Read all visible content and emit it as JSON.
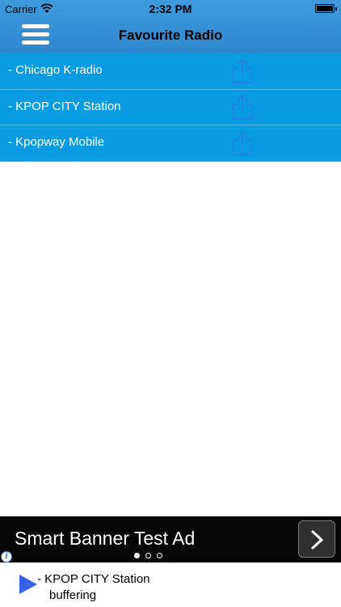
{
  "status_bar": {
    "carrier": "Carrier",
    "time": "2:32 PM",
    "wifi_icon": "wifi-icon",
    "battery_icon": "battery-icon"
  },
  "nav": {
    "title": "Favourite Radio",
    "menu_icon": "hamburger-menu-icon"
  },
  "radio_list": {
    "items": [
      {
        "label": "- Chicago K-radio",
        "action_icon": "share-icon"
      },
      {
        "label": "- KPOP CITY Station",
        "action_icon": "share-icon"
      },
      {
        "label": "- Kpopway Mobile",
        "action_icon": "share-icon"
      }
    ]
  },
  "ad_banner": {
    "text": "Smart Banner Test Ad",
    "arrow_icon": "chevron-right-icon",
    "info_icon": "info-icon",
    "page_count": 3,
    "active_page": 1
  },
  "player": {
    "station": "- KPOP CITY Station",
    "status": "buffering",
    "play_icon": "play-icon"
  },
  "colors": {
    "header": "#3a94d8",
    "list_item": "#0a9ce2",
    "play": "#3560e8",
    "ad_background": "#050505"
  }
}
